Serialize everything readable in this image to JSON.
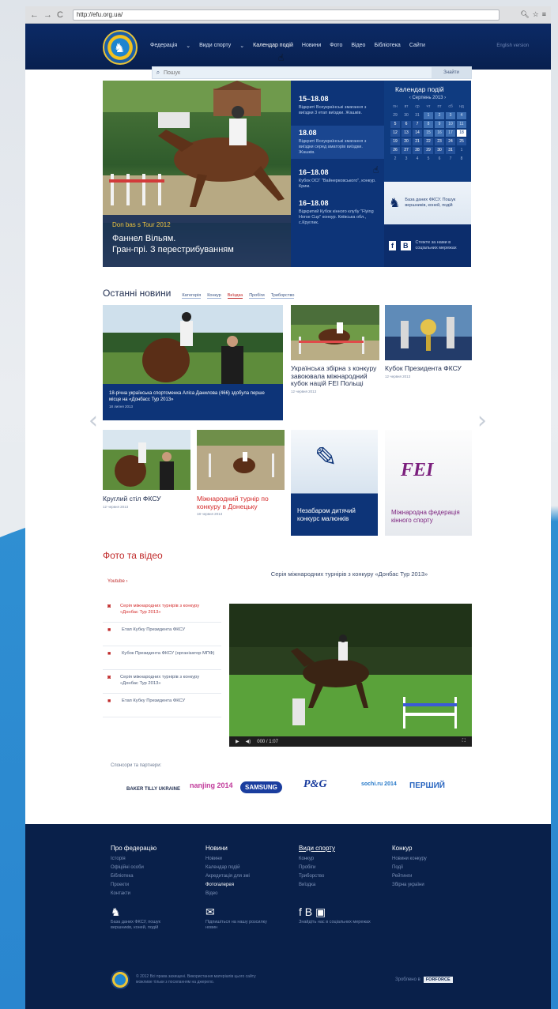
{
  "browser": {
    "url": "http://efu.org.ua/"
  },
  "header": {
    "menu": [
      {
        "label": "Федерація",
        "dd": true
      },
      {
        "label": "Види спорту",
        "dd": true
      },
      {
        "label": "Календар подій",
        "dd": false
      },
      {
        "label": "Новини",
        "dd": false
      },
      {
        "label": "Фото",
        "dd": false
      },
      {
        "label": "Відео",
        "dd": false
      },
      {
        "label": "Бібліотека",
        "dd": false
      },
      {
        "label": "Сайти",
        "dd": false
      }
    ],
    "english": "English version"
  },
  "search": {
    "placeholder": "Пошук",
    "button": "Знайти"
  },
  "hero": {
    "tag": "Don bas s Tour 2012",
    "title": "Фаннел Вільям.\nГран-прі. З перестрибуванням"
  },
  "events": [
    {
      "date": "15–18.08",
      "text": "Відкриті Всеукраїнські змагання з виїздки 3 етап виїздки. Жашків."
    },
    {
      "date": "18.08",
      "text": "Відкриті Всеукраїнські змагання з виїздки серед аматорів виїздки. Жашків."
    },
    {
      "date": "16–18.08",
      "text": "Кубок ОСГ \"Вайнерковського\", конкур. Крим."
    },
    {
      "date": "16–18.08",
      "text": "Відкритий Кубок кінного клубу \"Flying Horse Cup\" конкур. Київська обл., с.Круглик."
    }
  ],
  "calendar": {
    "title": "Календар подій",
    "month": "‹ Серпень 2013 ›",
    "weekdays": [
      "пн",
      "вт",
      "ср",
      "чт",
      "пт",
      "сб",
      "нд"
    ],
    "days": [
      "29",
      "30",
      "31",
      "1",
      "2",
      "3",
      "4",
      "5",
      "6",
      "7",
      "8",
      "9",
      "10",
      "11",
      "12",
      "13",
      "14",
      "15",
      "16",
      "17",
      "18",
      "19",
      "20",
      "21",
      "22",
      "23",
      "24",
      "25",
      "26",
      "27",
      "28",
      "29",
      "30",
      "31",
      "1",
      "2",
      "3",
      "4",
      "5",
      "6",
      "7",
      "8"
    ]
  },
  "database": {
    "text": "База даних ФКСУ. Пошук вершників, коней, подій"
  },
  "social": {
    "text": "Стежте за нами в соціальних мережах"
  },
  "news": {
    "heading": "Останні новини",
    "categories": [
      "Категорія",
      "Конкур",
      "Виїздка",
      "Пробіги",
      "Триборство"
    ],
    "items": [
      {
        "title": "18-річна українська спортсменка Аліса Данилова (466) здобула перше місце на «Донбасс Тур 2013»",
        "date": "18 липня 2013"
      },
      {
        "title": "Українська збірна з конкуру завоювала міжнародний кубок націй FEI Польщі",
        "date": "12 червня 2013"
      },
      {
        "title": "Кубок Президента ФКСУ",
        "date": "12 червня 2013"
      },
      {
        "title": "Круглий стіл ФКСУ",
        "date": "12 червня 2013"
      },
      {
        "title": "Міжнародний турнір по конкуру в Донецьку",
        "date": "18 червня 2013"
      },
      {
        "title": "Незабаром дитячий конкурс малюнків",
        "date": ""
      },
      {
        "title": "Міжнародна федерація кінного спорту",
        "date": ""
      }
    ]
  },
  "media": {
    "heading": "Фото та відео",
    "youtube": "Youtube ›",
    "video_title": "Серія міжнародних турнірів з конкуру «Донбас Тур 2013»",
    "list": [
      "Серія міжнародних турнірів з конкуру «Донбас Тур 2013»",
      "Етап Кубку Президента ФКСУ",
      "Кубок Президента ФКСУ (організатор МПФ)",
      "Серія міжнародних турнірів з конкуру «Донбас Тур 2013»",
      "Етап Кубку Президента ФКСУ"
    ],
    "time": "000 / 1:07"
  },
  "sponsors": {
    "label": "Спонсори та партнери:",
    "items": [
      "BAKER TILLY UKRAINE",
      "nanjing 2014",
      "SAMSUNG",
      "P&G",
      "sochi.ru 2014",
      "ПЕРШИЙ"
    ]
  },
  "footer": {
    "cols": [
      {
        "h": "Про федерацію",
        "items": [
          "Історія",
          "Офіційні особи",
          "Бібліотека",
          "Проекти",
          "Контакти"
        ]
      },
      {
        "h": "Новини",
        "items": [
          "Новини",
          "Календар подій",
          "Акредитація для змі",
          "Фотогалерея",
          "Відео"
        ]
      },
      {
        "h": "Види спорту",
        "items": [
          "Конкур",
          "Пробіги",
          "Триборство",
          "Виїздка"
        ]
      },
      {
        "h": "Конкур",
        "items": [
          "Новини конкуру",
          "Події",
          "Рейтинги",
          "Збірна україни"
        ]
      }
    ],
    "blocks": [
      "База даних ФКСУ, пошук вершників, коней, подій",
      "Підпишіться на нашу розсилку новин",
      "Знайдіть нас в соціальних мережах"
    ],
    "copyright": "© 2012 Всі права захищені. Використання матеріалів цього сайту можливе тільки з посиланням на джерело.",
    "made_by": "Зроблено в",
    "agency": "FORFORCE"
  },
  "colors": {
    "navy": "#09204a",
    "accent_red": "#d42b2b",
    "blue": "#0d3478"
  }
}
